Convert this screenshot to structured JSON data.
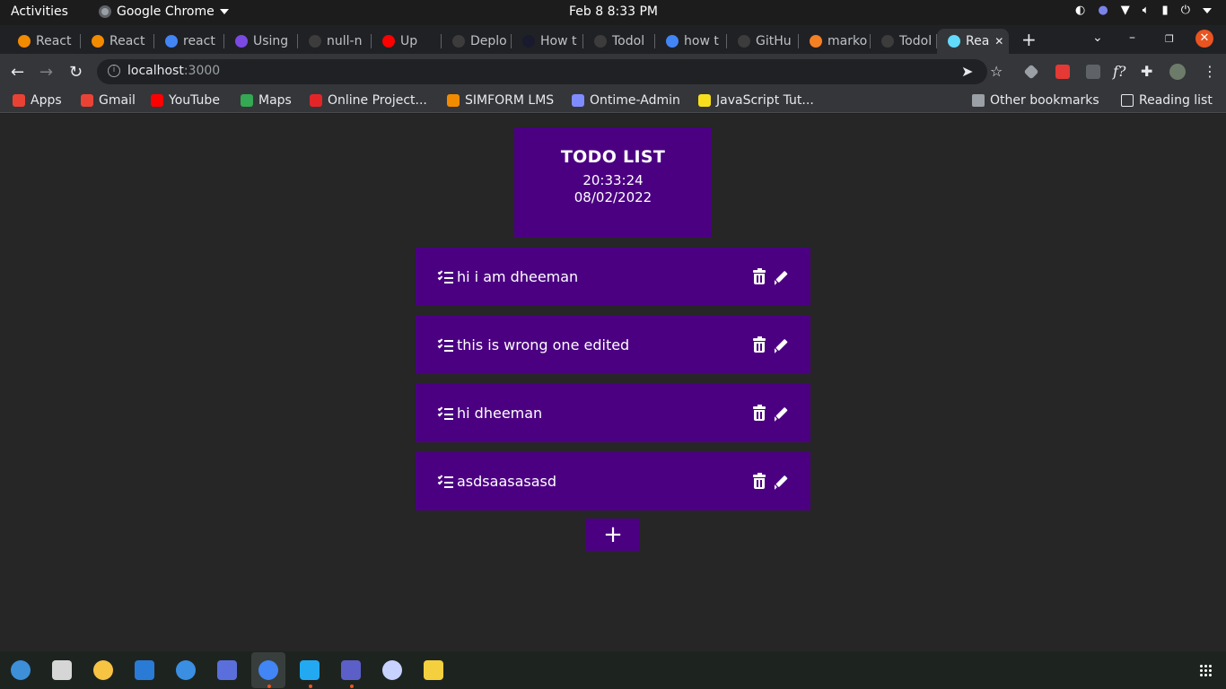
{
  "system_bar": {
    "activities": "Activities",
    "app_name": "Google Chrome",
    "clock": "Feb 8   8:33 PM"
  },
  "tabs": [
    {
      "title": "React",
      "favicon": "medium-icon",
      "color": "#f28b00"
    },
    {
      "title": "React",
      "favicon": "medium-icon",
      "color": "#f28b00"
    },
    {
      "title": "react",
      "favicon": "google-icon",
      "color": "#4285f4"
    },
    {
      "title": "Using",
      "favicon": "bookmark-icon",
      "color": "#7b4ae2"
    },
    {
      "title": "null-n",
      "favicon": "github-icon",
      "color": "#3c3c3c"
    },
    {
      "title": "Up",
      "favicon": "youtube-icon",
      "color": "#ff0000"
    },
    {
      "title": "Deplo",
      "favicon": "github-icon",
      "color": "#3c3c3c"
    },
    {
      "title": "How t",
      "favicon": "lambda-icon",
      "color": "#1a1a2e"
    },
    {
      "title": "Todol",
      "favicon": "github-icon",
      "color": "#3c3c3c"
    },
    {
      "title": "how t",
      "favicon": "google-icon",
      "color": "#4285f4"
    },
    {
      "title": "GitHu",
      "favicon": "github-icon",
      "color": "#3c3c3c"
    },
    {
      "title": "marko",
      "favicon": "stackoverflow-icon",
      "color": "#f48024"
    },
    {
      "title": "Todol",
      "favicon": "github-icon",
      "color": "#3c3c3c"
    },
    {
      "title": "Rea",
      "favicon": "react-icon",
      "color": "#61dafb",
      "active": true
    }
  ],
  "address_bar": {
    "host": "localhost",
    "port": ":3000"
  },
  "bookmarks": [
    {
      "label": "Apps",
      "icon": "apps-grid-icon",
      "color": "#e94235"
    },
    {
      "label": "Gmail",
      "icon": "gmail-icon",
      "color": "#ea4335"
    },
    {
      "label": "YouTube",
      "icon": "youtube-icon",
      "color": "#ff0000"
    },
    {
      "label": "Maps",
      "icon": "maps-icon",
      "color": "#34a853"
    },
    {
      "label": "Online Project...",
      "icon": "zoho-icon",
      "color": "#e42527"
    },
    {
      "label": "SIMFORM LMS",
      "icon": "medium-icon",
      "color": "#f28b00"
    },
    {
      "label": "Ontime-Admin",
      "icon": "check-icon",
      "color": "#7f8cff"
    },
    {
      "label": "JavaScript Tut...",
      "icon": "js-icon",
      "color": "#f7df1e"
    }
  ],
  "bookmarks_right": {
    "other": "Other bookmarks",
    "reading": "Reading list"
  },
  "app": {
    "title": "TODO LIST",
    "time": "20:33:24",
    "date": "08/02/2022",
    "add_label": "+",
    "accent": "#4b0082",
    "todos": [
      {
        "text": "hi i am dheeman"
      },
      {
        "text": "this is wrong one edited"
      },
      {
        "text": "hi dheeman"
      },
      {
        "text": "asdsaasasasd"
      }
    ]
  },
  "dock": [
    {
      "name": "thunderbird-icon",
      "color": "#3d8fd8"
    },
    {
      "name": "files-icon",
      "color": "#d6d6d6"
    },
    {
      "name": "rhythmbox-icon",
      "color": "#f6c343"
    },
    {
      "name": "writer-icon",
      "color": "#2a7bd5"
    },
    {
      "name": "help-icon",
      "color": "#3b8fe3"
    },
    {
      "name": "screenshot-icon",
      "color": "#5a6fdb"
    },
    {
      "name": "chrome-icon",
      "color": "#4285f4"
    },
    {
      "name": "vscode-icon",
      "color": "#23a9f2"
    },
    {
      "name": "teams-icon",
      "color": "#5b5fc7"
    },
    {
      "name": "ontime-icon",
      "color": "#c7d2fe"
    },
    {
      "name": "notes-icon",
      "color": "#f4d03f"
    }
  ]
}
